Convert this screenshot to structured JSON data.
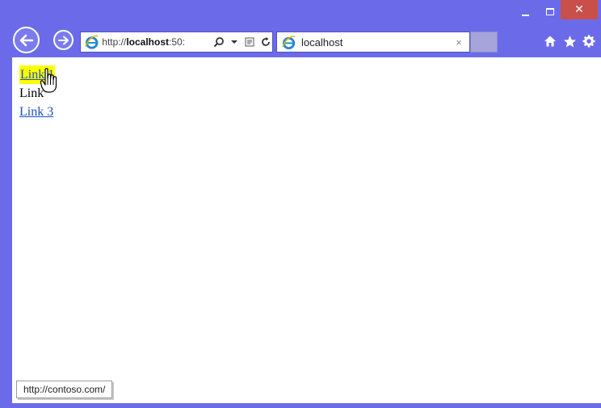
{
  "window": {
    "close_symbol": "✕",
    "accent": "#6b6bea",
    "close_color": "#c9504a"
  },
  "address_bar": {
    "url_prefix": "http://",
    "url_host": "localhost",
    "url_rest": ":50:",
    "search_icon": "search-icon",
    "dropdown_icon": "dropdown-icon",
    "compat_icon": "compatibility-view-icon",
    "refresh_icon": "refresh-icon"
  },
  "tab": {
    "title": "localhost",
    "close_symbol": "×"
  },
  "page": {
    "links": [
      {
        "label": "Link 1",
        "state": "focused-highlighted"
      },
      {
        "label": "Link",
        "state": "plain-text-under-cursor"
      },
      {
        "label": "Link 3",
        "state": "link"
      }
    ],
    "highlight_color": "#ffff00",
    "link_color": "#1a4fc2"
  },
  "status_bar": {
    "url": "http://contoso.com/"
  }
}
